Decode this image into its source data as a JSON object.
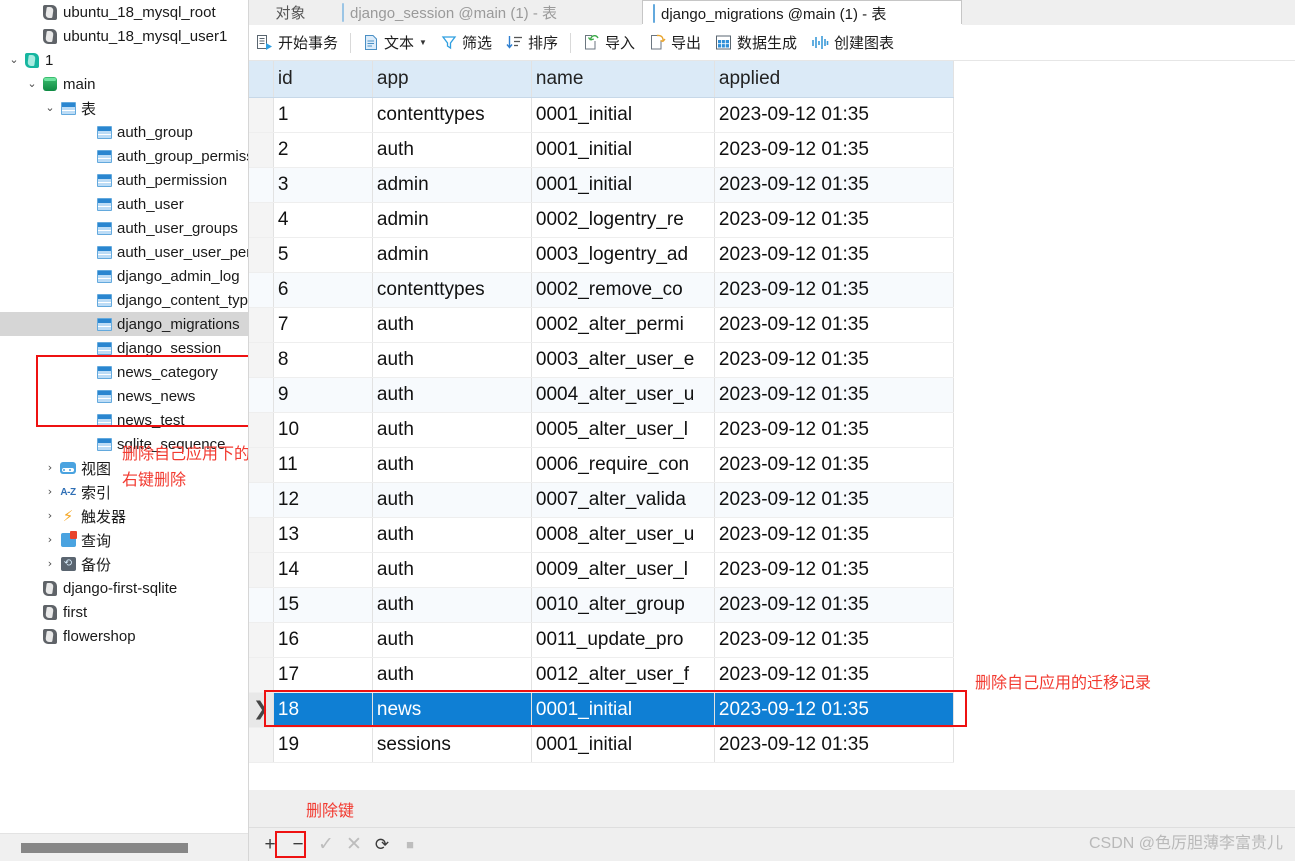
{
  "sidebar": {
    "items": [
      {
        "label": "ubuntu_18_mysql_root",
        "icon": "feather-icon",
        "indent": 1,
        "chevron": "",
        "selected": false
      },
      {
        "label": "ubuntu_18_mysql_user1",
        "icon": "feather-icon",
        "indent": 1,
        "chevron": "",
        "selected": false
      },
      {
        "label": "1",
        "icon": "feather-teal-icon",
        "indent": 0,
        "chevron": "v",
        "selected": false
      },
      {
        "label": "main",
        "icon": "database-icon",
        "indent": 1,
        "chevron": "v",
        "selected": false
      },
      {
        "label": "表",
        "icon": "table-folder-icon",
        "indent": 2,
        "chevron": "v",
        "selected": false
      },
      {
        "label": "auth_group",
        "icon": "table-icon",
        "indent": 4,
        "chevron": "",
        "selected": false
      },
      {
        "label": "auth_group_permissi",
        "icon": "table-icon",
        "indent": 4,
        "chevron": "",
        "selected": false
      },
      {
        "label": "auth_permission",
        "icon": "table-icon",
        "indent": 4,
        "chevron": "",
        "selected": false
      },
      {
        "label": "auth_user",
        "icon": "table-icon",
        "indent": 4,
        "chevron": "",
        "selected": false
      },
      {
        "label": "auth_user_groups",
        "icon": "table-icon",
        "indent": 4,
        "chevron": "",
        "selected": false
      },
      {
        "label": "auth_user_user_perm",
        "icon": "table-icon",
        "indent": 4,
        "chevron": "",
        "selected": false
      },
      {
        "label": "django_admin_log",
        "icon": "table-icon",
        "indent": 4,
        "chevron": "",
        "selected": false
      },
      {
        "label": "django_content_type",
        "icon": "table-icon",
        "indent": 4,
        "chevron": "",
        "selected": false
      },
      {
        "label": "django_migrations",
        "icon": "table-icon",
        "indent": 4,
        "chevron": "",
        "selected": true
      },
      {
        "label": "django_session",
        "icon": "table-icon",
        "indent": 4,
        "chevron": "",
        "selected": false
      },
      {
        "label": "news_category",
        "icon": "table-icon",
        "indent": 4,
        "chevron": "",
        "selected": false
      },
      {
        "label": "news_news",
        "icon": "table-icon",
        "indent": 4,
        "chevron": "",
        "selected": false
      },
      {
        "label": "news_test",
        "icon": "table-icon",
        "indent": 4,
        "chevron": "",
        "selected": false
      },
      {
        "label": "sqlite_sequence",
        "icon": "table-icon",
        "indent": 4,
        "chevron": "",
        "selected": false
      },
      {
        "label": "视图",
        "icon": "view-icon",
        "indent": 2,
        "chevron": ">",
        "selected": false
      },
      {
        "label": "索引",
        "icon": "az-icon",
        "indent": 2,
        "chevron": ">",
        "selected": false
      },
      {
        "label": "触发器",
        "icon": "bolt-icon",
        "indent": 2,
        "chevron": ">",
        "selected": false
      },
      {
        "label": "查询",
        "icon": "query-icon",
        "indent": 2,
        "chevron": ">",
        "selected": false
      },
      {
        "label": "备份",
        "icon": "backup-icon",
        "indent": 2,
        "chevron": ">",
        "selected": false
      },
      {
        "label": "django-first-sqlite",
        "icon": "feather-icon",
        "indent": 1,
        "chevron": "",
        "selected": false
      },
      {
        "label": "first",
        "icon": "feather-icon",
        "indent": 1,
        "chevron": "",
        "selected": false
      },
      {
        "label": "flowershop",
        "icon": "feather-icon",
        "indent": 1,
        "chevron": "",
        "selected": false
      }
    ]
  },
  "tabs": {
    "object_label": "对象",
    "items": [
      {
        "label": "django_session @main (1) - 表",
        "active": false
      },
      {
        "label": "django_migrations @main (1) - 表",
        "active": true
      }
    ]
  },
  "toolbar": {
    "items": [
      {
        "label": "开始事务",
        "icon": "transaction-icon",
        "caret": false
      },
      {
        "label": "文本",
        "icon": "text-icon",
        "caret": true
      },
      {
        "label": "筛选",
        "icon": "filter-icon",
        "caret": false
      },
      {
        "label": "排序",
        "icon": "sort-icon",
        "caret": false
      },
      {
        "label": "导入",
        "icon": "import-icon",
        "caret": false
      },
      {
        "label": "导出",
        "icon": "export-icon",
        "caret": false
      },
      {
        "label": "数据生成",
        "icon": "data-generate-icon",
        "caret": false
      },
      {
        "label": "创建图表",
        "icon": "create-chart-icon",
        "caret": false
      }
    ]
  },
  "grid": {
    "columns": [
      "id",
      "app",
      "name",
      "applied"
    ],
    "rows": [
      {
        "id": "1",
        "app": "contenttypes",
        "name": "0001_initial",
        "applied": "2023-09-12 01:35"
      },
      {
        "id": "2",
        "app": "auth",
        "name": "0001_initial",
        "applied": "2023-09-12 01:35"
      },
      {
        "id": "3",
        "app": "admin",
        "name": "0001_initial",
        "applied": "2023-09-12 01:35"
      },
      {
        "id": "4",
        "app": "admin",
        "name": "0002_logentry_re",
        "applied": "2023-09-12 01:35"
      },
      {
        "id": "5",
        "app": "admin",
        "name": "0003_logentry_ad",
        "applied": "2023-09-12 01:35"
      },
      {
        "id": "6",
        "app": "contenttypes",
        "name": "0002_remove_co",
        "applied": "2023-09-12 01:35"
      },
      {
        "id": "7",
        "app": "auth",
        "name": "0002_alter_permi",
        "applied": "2023-09-12 01:35"
      },
      {
        "id": "8",
        "app": "auth",
        "name": "0003_alter_user_e",
        "applied": "2023-09-12 01:35"
      },
      {
        "id": "9",
        "app": "auth",
        "name": "0004_alter_user_u",
        "applied": "2023-09-12 01:35"
      },
      {
        "id": "10",
        "app": "auth",
        "name": "0005_alter_user_l",
        "applied": "2023-09-12 01:35"
      },
      {
        "id": "11",
        "app": "auth",
        "name": "0006_require_con",
        "applied": "2023-09-12 01:35"
      },
      {
        "id": "12",
        "app": "auth",
        "name": "0007_alter_valida",
        "applied": "2023-09-12 01:35"
      },
      {
        "id": "13",
        "app": "auth",
        "name": "0008_alter_user_u",
        "applied": "2023-09-12 01:35"
      },
      {
        "id": "14",
        "app": "auth",
        "name": "0009_alter_user_l",
        "applied": "2023-09-12 01:35"
      },
      {
        "id": "15",
        "app": "auth",
        "name": "0010_alter_group",
        "applied": "2023-09-12 01:35"
      },
      {
        "id": "16",
        "app": "auth",
        "name": "0011_update_pro",
        "applied": "2023-09-12 01:35"
      },
      {
        "id": "17",
        "app": "auth",
        "name": "0012_alter_user_f",
        "applied": "2023-09-12 01:35"
      },
      {
        "id": "18",
        "app": "news",
        "name": "0001_initial",
        "applied": "2023-09-12 01:35",
        "selected": true
      },
      {
        "id": "19",
        "app": "sessions",
        "name": "0001_initial",
        "applied": "2023-09-12 01:35"
      }
    ]
  },
  "annotations": {
    "sidebar_tables_line1": "删除自己应用下的表",
    "sidebar_tables_line2": "右键删除",
    "selected_row_note": "删除自己应用的迁移记录",
    "delete_key_note": "删除键"
  },
  "statusbar": {
    "buttons": [
      {
        "name": "add-record-button",
        "glyph": "+",
        "dim": false
      },
      {
        "name": "delete-record-button",
        "glyph": "−",
        "dim": false
      },
      {
        "name": "apply-change-button",
        "glyph": "✓",
        "dim": true
      },
      {
        "name": "cancel-change-button",
        "glyph": "✕",
        "dim": true
      },
      {
        "name": "refresh-button",
        "glyph": "⟳",
        "dim": false
      },
      {
        "name": "stop-button",
        "glyph": "■",
        "dim": true
      }
    ]
  },
  "watermark": "CSDN @色厉胆薄李富贵儿",
  "colors": {
    "selection_blue": "#0f7fd4",
    "annotation_red": "#f23a30",
    "header_blue": "#dbeaf7"
  }
}
